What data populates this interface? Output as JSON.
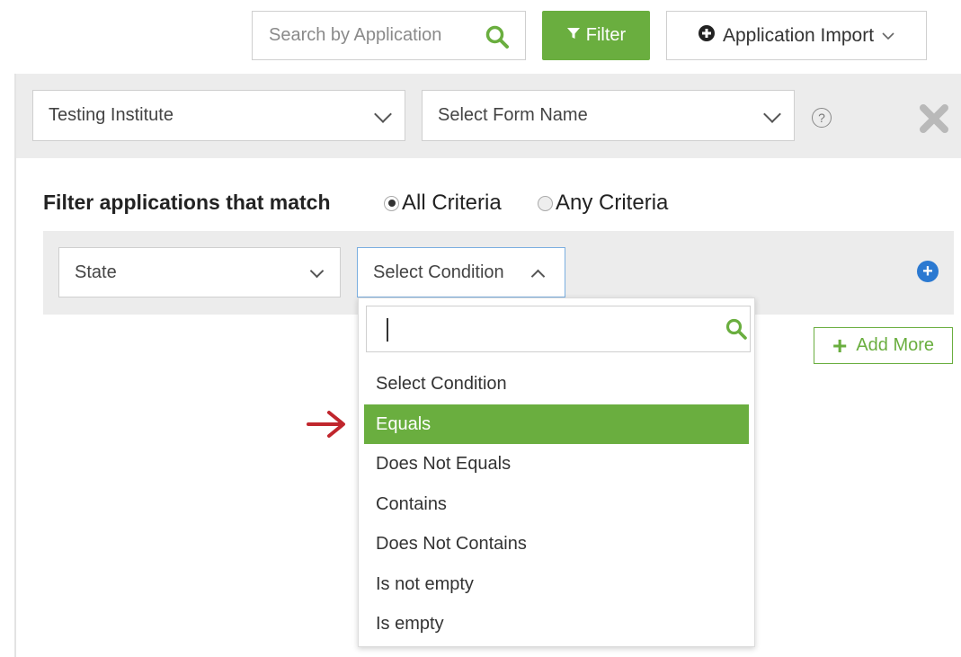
{
  "toolbar": {
    "search_placeholder": "Search by Application",
    "filter_label": "Filter",
    "import_label": "Application Import"
  },
  "filter_panel": {
    "institute_select": "Testing Institute",
    "form_select": "Select Form Name",
    "help_symbol": "?",
    "match_title": "Filter applications that match",
    "radio_all": "All Criteria",
    "radio_any": "Any Criteria",
    "selected_match": "All Criteria",
    "field_select": "State",
    "condition_select": "Select Condition",
    "add_more_label": "Add More"
  },
  "condition_dropdown": {
    "search_value": "",
    "highlighted": "Equals",
    "options": [
      "Select Condition",
      "Equals",
      "Does Not Equals",
      "Contains",
      "Does Not Contains",
      "Is not empty",
      "Is empty"
    ]
  },
  "colors": {
    "accent_green": "#6aae3f",
    "blue_add": "#2b79d1",
    "arrow_red": "#c0262d"
  }
}
